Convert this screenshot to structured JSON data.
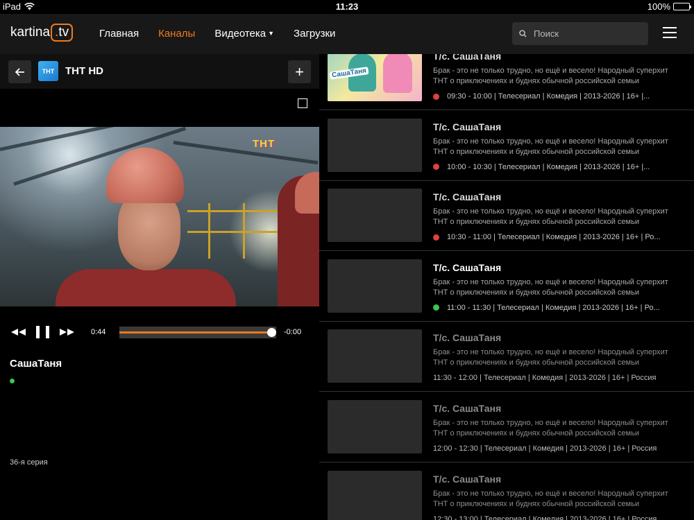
{
  "status_bar": {
    "carrier": "iPad",
    "time": "11:23",
    "battery": "100%",
    "battery_level": 1.0
  },
  "header": {
    "logo_left": "kartina",
    "logo_dot": ".",
    "logo_right": "tv",
    "accent_color": "#f07a1e",
    "nav": [
      {
        "label": "Главная",
        "active": false
      },
      {
        "label": "Каналы",
        "active": true
      },
      {
        "label": "Видеотека",
        "active": false,
        "has_dropdown": true
      },
      {
        "label": "Загрузки",
        "active": false
      }
    ],
    "search": {
      "placeholder": "Поиск",
      "value": ""
    }
  },
  "channel": {
    "name": "ТНТ HD",
    "logo_text": "ТНТ",
    "watermark": "ТНТ"
  },
  "player": {
    "current_time": "0:44",
    "remaining_time": "-0:00",
    "progress": 0.97,
    "program_title": "СашаТаня",
    "episode": "36-я серия",
    "live_color": "#3ec34f"
  },
  "schedule": [
    {
      "title": "Т/с. СашаТаня",
      "thumb_label": "СашаТаня",
      "description": "Брак - это не только трудно, но ещё и весело! Народный суперхит ТНТ о приключениях и буднях обычной российской семьи",
      "meta": "09:30 - 10:00  |  Телесериал  |  Комедия  |  2013-2026  |  16+  |...",
      "status": "past",
      "dot_color": "#e0413c"
    },
    {
      "title": "Т/с. СашаТаня",
      "description": "Брак - это не только трудно, но ещё и весело! Народный суперхит ТНТ о приключениях и буднях обычной российской семьи",
      "meta": "10:00 - 10:30  |  Телесериал  |  Комедия  |  2013-2026  |  16+  |...",
      "status": "past",
      "dot_color": "#e0413c"
    },
    {
      "title": "Т/с. СашаТаня",
      "description": "Брак - это не только трудно, но ещё и весело! Народный суперхит ТНТ о приключениях и буднях обычной российской семьи",
      "meta": "10:30 - 11:00  |  Телесериал  |  Комедия  |  2013-2026  |  16+  |  Ро...",
      "status": "past",
      "dot_color": "#e0413c"
    },
    {
      "title": "Т/с. СашаТаня",
      "description": "Брак - это не только трудно, но ещё и весело! Народный суперхит ТНТ о приключениях и буднях обычной российской семьи",
      "meta": "11:00 - 11:30  |  Телесериал  |  Комедия  |  2013-2026  |  16+  |  Ро...",
      "status": "current",
      "dot_color": "#3ec34f"
    },
    {
      "title": "Т/с. СашаТаня",
      "description": "Брак - это не только трудно, но ещё и весело! Народный суперхит ТНТ о приключениях и буднях обычной российской семьи",
      "meta": "11:30 - 12:00  |  Телесериал  |  Комедия  |  2013-2026  |  16+  |  Россия",
      "status": "future"
    },
    {
      "title": "Т/с. СашаТаня",
      "description": "Брак - это не только трудно, но ещё и весело! Народный суперхит ТНТ о приключениях и буднях обычной российской семьи",
      "meta": "12:00 - 12:30  |  Телесериал  |  Комедия  |  2013-2026  |  16+  |  Россия",
      "status": "future"
    },
    {
      "title": "Т/с. СашаТаня",
      "description": "Брак - это не только трудно, но ещё и весело! Народный суперхит ТНТ о приключениях и буднях обычной российской семьи",
      "meta": "12:30 - 13:00  |  Телесериал  |  Комедия  |  2013-2026  |  16+  |  Россия",
      "status": "future"
    }
  ]
}
